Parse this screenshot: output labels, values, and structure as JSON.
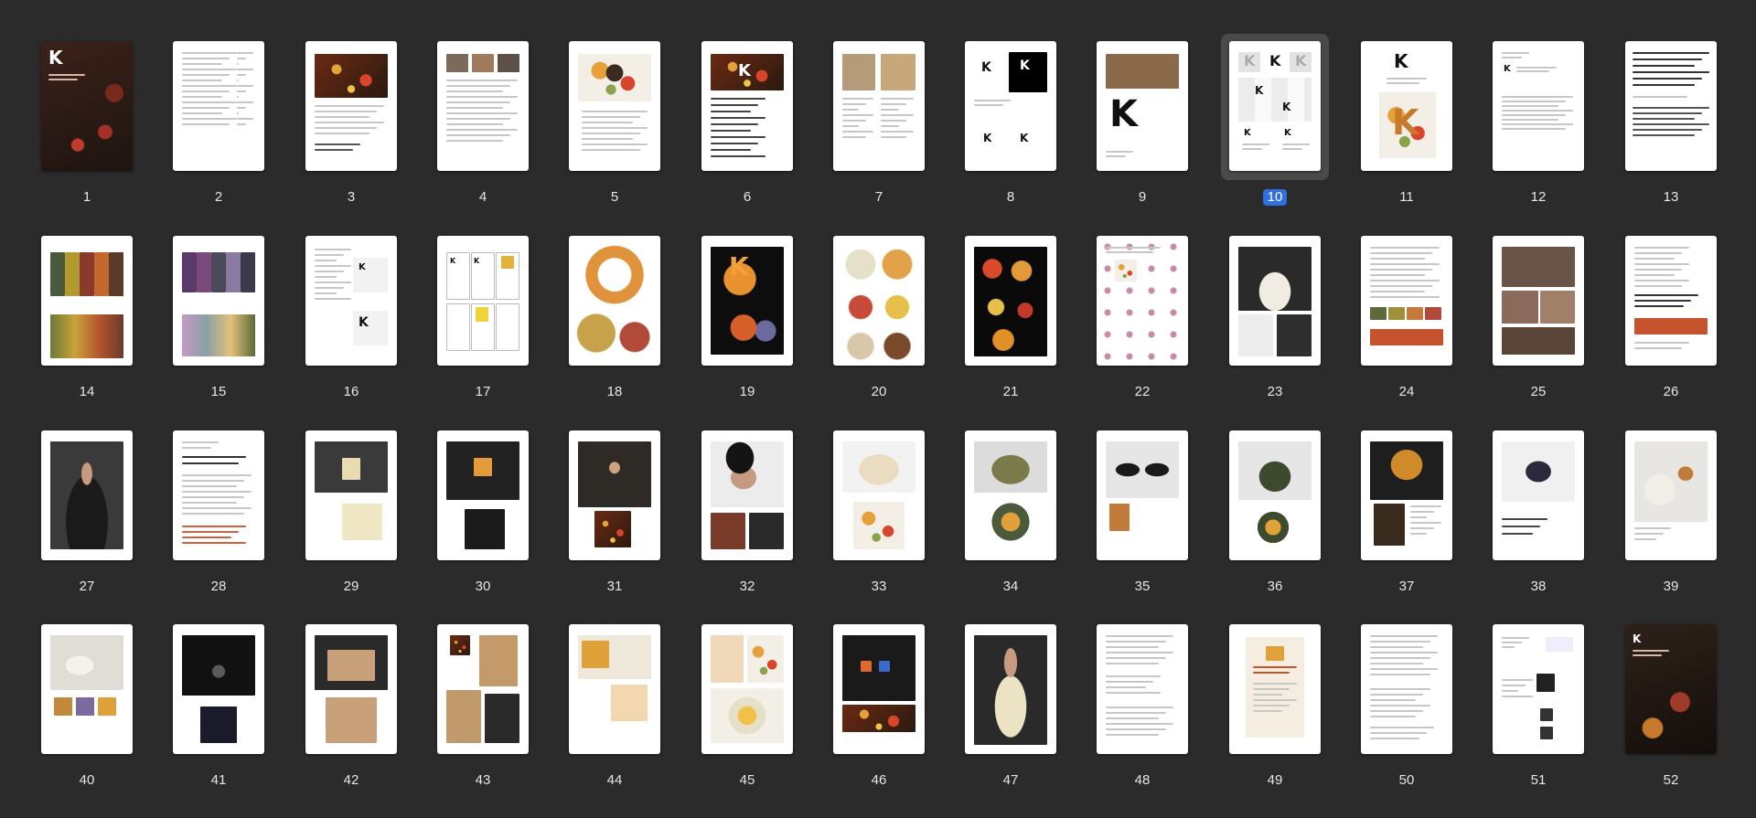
{
  "app": {
    "accent_color": "#2f6fe0",
    "background_color": "#2b2b2b",
    "selected_page": 10
  },
  "pages": [
    {
      "n": "1",
      "style": "cover-dark"
    },
    {
      "n": "2",
      "style": "text-list"
    },
    {
      "n": "3",
      "style": "photo-top-text"
    },
    {
      "n": "4",
      "style": "photo-row-text"
    },
    {
      "n": "5",
      "style": "photo-center-text"
    },
    {
      "n": "6",
      "style": "photo-top-headings"
    },
    {
      "n": "7",
      "style": "photo-top-columns"
    },
    {
      "n": "8",
      "style": "logos-grid"
    },
    {
      "n": "9",
      "style": "photo-logo"
    },
    {
      "n": "10",
      "style": "logo-variants"
    },
    {
      "n": "11",
      "style": "logo-pattern"
    },
    {
      "n": "12",
      "style": "logo-text"
    },
    {
      "n": "13",
      "style": "typography"
    },
    {
      "n": "14",
      "style": "colors-blocks"
    },
    {
      "n": "15",
      "style": "colors-purple"
    },
    {
      "n": "16",
      "style": "layout-boxes"
    },
    {
      "n": "17",
      "style": "layout-grid"
    },
    {
      "n": "18",
      "style": "wreath"
    },
    {
      "n": "19",
      "style": "dark-ornament"
    },
    {
      "n": "20",
      "style": "ornaments"
    },
    {
      "n": "21",
      "style": "dark-ornaments"
    },
    {
      "n": "22",
      "style": "pattern"
    },
    {
      "n": "23",
      "style": "dress-photo"
    },
    {
      "n": "24",
      "style": "text-swatches"
    },
    {
      "n": "25",
      "style": "photo-collage"
    },
    {
      "n": "26",
      "style": "text-red"
    },
    {
      "n": "27",
      "style": "hoodie-woman"
    },
    {
      "n": "28",
      "style": "text-headings"
    },
    {
      "n": "29",
      "style": "tshirt-woman"
    },
    {
      "n": "30",
      "style": "hoodie-black"
    },
    {
      "n": "31",
      "style": "scarf-woman"
    },
    {
      "n": "32",
      "style": "beanie-man"
    },
    {
      "n": "33",
      "style": "cap"
    },
    {
      "n": "34",
      "style": "gloves"
    },
    {
      "n": "35",
      "style": "sunglasses"
    },
    {
      "n": "36",
      "style": "tote"
    },
    {
      "n": "37",
      "style": "umbrella"
    },
    {
      "n": "38",
      "style": "phone"
    },
    {
      "n": "39",
      "style": "box"
    },
    {
      "n": "40",
      "style": "dishes"
    },
    {
      "n": "41",
      "style": "bottle-dark"
    },
    {
      "n": "42",
      "style": "packaging"
    },
    {
      "n": "43",
      "style": "bags"
    },
    {
      "n": "44",
      "style": "stationery"
    },
    {
      "n": "45",
      "style": "posters"
    },
    {
      "n": "46",
      "style": "app-ui"
    },
    {
      "n": "47",
      "style": "social"
    },
    {
      "n": "48",
      "style": "text-doc"
    },
    {
      "n": "49",
      "style": "certificate"
    },
    {
      "n": "50",
      "style": "text-doc2"
    },
    {
      "n": "51",
      "style": "contacts"
    },
    {
      "n": "52",
      "style": "back-cover"
    }
  ]
}
